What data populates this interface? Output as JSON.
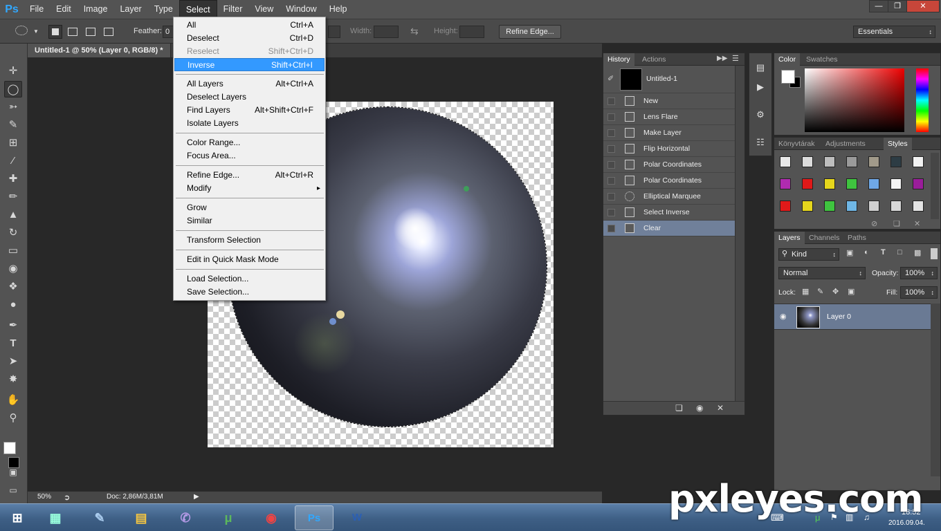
{
  "app": {
    "logo": "Ps"
  },
  "menubar": {
    "items": [
      "File",
      "Edit",
      "Image",
      "Layer",
      "Type",
      "Select",
      "Filter",
      "View",
      "Window",
      "Help"
    ],
    "active": "Select"
  },
  "options": {
    "feather_label": "Feather:",
    "feather_value": "0",
    "width_label": "Width:",
    "height_label": "Height:",
    "refine_edge": "Refine Edge...",
    "workspace": "Essentials"
  },
  "document": {
    "tab_title": "Untitled-1 @ 50% (Layer 0, RGB/8) *",
    "zoom": "50%",
    "doc_info": "Doc: 2,86M/3,81M"
  },
  "select_menu": {
    "items": [
      {
        "label": "All",
        "shortcut": "Ctrl+A"
      },
      {
        "label": "Deselect",
        "shortcut": "Ctrl+D"
      },
      {
        "label": "Reselect",
        "shortcut": "Shift+Ctrl+D",
        "disabled": true
      },
      {
        "label": "Inverse",
        "shortcut": "Shift+Ctrl+I",
        "highlighted": true
      },
      {
        "label": "All Layers",
        "shortcut": "Alt+Ctrl+A"
      },
      {
        "label": "Deselect Layers",
        "shortcut": ""
      },
      {
        "label": "Find Layers",
        "shortcut": "Alt+Shift+Ctrl+F"
      },
      {
        "label": "Isolate Layers",
        "shortcut": ""
      },
      {
        "label": "Color Range...",
        "shortcut": ""
      },
      {
        "label": "Focus Area...",
        "shortcut": ""
      },
      {
        "label": "Refine Edge...",
        "shortcut": "Alt+Ctrl+R"
      },
      {
        "label": "Modify",
        "shortcut": "▸"
      },
      {
        "label": "Grow",
        "shortcut": ""
      },
      {
        "label": "Similar",
        "shortcut": ""
      },
      {
        "label": "Transform Selection",
        "shortcut": ""
      },
      {
        "label": "Edit in Quick Mask Mode",
        "shortcut": ""
      },
      {
        "label": "Load Selection...",
        "shortcut": ""
      },
      {
        "label": "Save Selection...",
        "shortcut": ""
      }
    ]
  },
  "history": {
    "tabs": [
      "History",
      "Actions"
    ],
    "snapshot": "Untitled-1",
    "steps": [
      "New",
      "Lens Flare",
      "Make Layer",
      "Flip Horizontal",
      "Polar Coordinates",
      "Polar Coordinates",
      "Elliptical Marquee",
      "Select Inverse",
      "Clear"
    ],
    "active_step": "Clear"
  },
  "color_panel": {
    "tabs": [
      "Color",
      "Swatches"
    ]
  },
  "styles_panel": {
    "tabs": [
      "Könyvtárak",
      "Adjustments",
      "Styles"
    ]
  },
  "layers_panel": {
    "tabs": [
      "Layers",
      "Channels",
      "Paths"
    ],
    "filter": "Kind",
    "blend_mode": "Normal",
    "opacity_label": "Opacity:",
    "opacity": "100%",
    "lock_label": "Lock:",
    "fill_label": "Fill:",
    "fill": "100%",
    "layers": [
      {
        "name": "Layer 0"
      }
    ]
  },
  "watermark": "pxleyes.com",
  "taskbar": {
    "time": "18:52",
    "date": "2016.09.04."
  },
  "colors": {
    "accent": "#3399ff",
    "history_selected": "#70809a",
    "layer_selected": "#6a7a94"
  }
}
